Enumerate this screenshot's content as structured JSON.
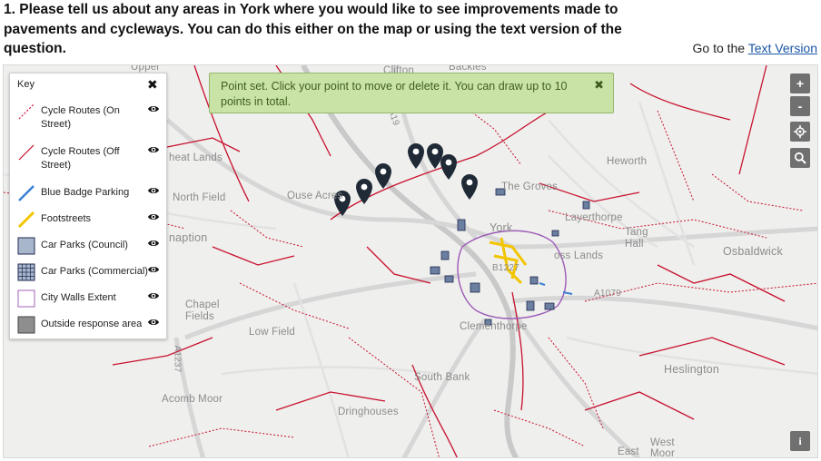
{
  "question": {
    "text": "1. Please tell us about any areas in York where you would like to see improvements made to pavements and cycleways. You can do this either on the map or using the text version of the question."
  },
  "text_version": {
    "prefix": "Go to the",
    "link": "Text Version"
  },
  "notice": {
    "text": "Point set. Click your point to move or delete it. You can draw up to 10 points in total.",
    "close": "✖"
  },
  "key": {
    "title": "Key",
    "close": "✖",
    "items": [
      {
        "label": "Cycle Routes (On Street)",
        "icon": "dashed-red-line-icon"
      },
      {
        "label": "Cycle Routes (Off Street)",
        "icon": "solid-red-line-icon"
      },
      {
        "label": "Blue Badge Parking",
        "icon": "blue-line-icon"
      },
      {
        "label": "Footstreets",
        "icon": "yellow-line-icon"
      },
      {
        "label": "Car Parks (Council)",
        "icon": "blue-grey-square-icon"
      },
      {
        "label": "Car Parks (Commercial)",
        "icon": "grid-square-icon"
      },
      {
        "label": "City Walls Extent",
        "icon": "purple-outline-square-icon"
      },
      {
        "label": "Outside response area",
        "icon": "grey-square-icon"
      }
    ]
  },
  "map_controls": {
    "zoom_in": "+",
    "zoom_out": "-",
    "locate": "locate-icon",
    "search": "search-icon",
    "info": "i"
  },
  "places": {
    "upper": "Upper",
    "clifton": "Clifton",
    "backies": "Backies",
    "heat_lands": "heat Lands",
    "north_field": "North Field",
    "ouse_acres": "Ouse Acres",
    "the_groves": "The Groves",
    "layerthorpe": "Layerthorpe",
    "york": "York",
    "cross_lands": "oss Lands",
    "tang_hall": "Tang Hall",
    "osbaldwick": "Osbaldwick",
    "heworth": "Heworth",
    "naption": "naption",
    "chapel_fields": "Chapel Fields",
    "low_field": "Low Field",
    "clementhorpe": "Clementhorpe",
    "a1079": "A1079",
    "a1237": "A1237",
    "a19": "A19",
    "b1227": "B1227",
    "south_bank": "South Bank",
    "heslington": "Heslington",
    "acomb_moor": "Acomb Moor",
    "dringhouses": "Dringhouses",
    "east": "East",
    "west_moor": "West Moor"
  },
  "colors": {
    "cycle_route": "#c8102e",
    "notice_bg": "#c9e3a6",
    "marker": "#1f2a36",
    "control_bg": "#707070",
    "link": "#1a56a6"
  }
}
